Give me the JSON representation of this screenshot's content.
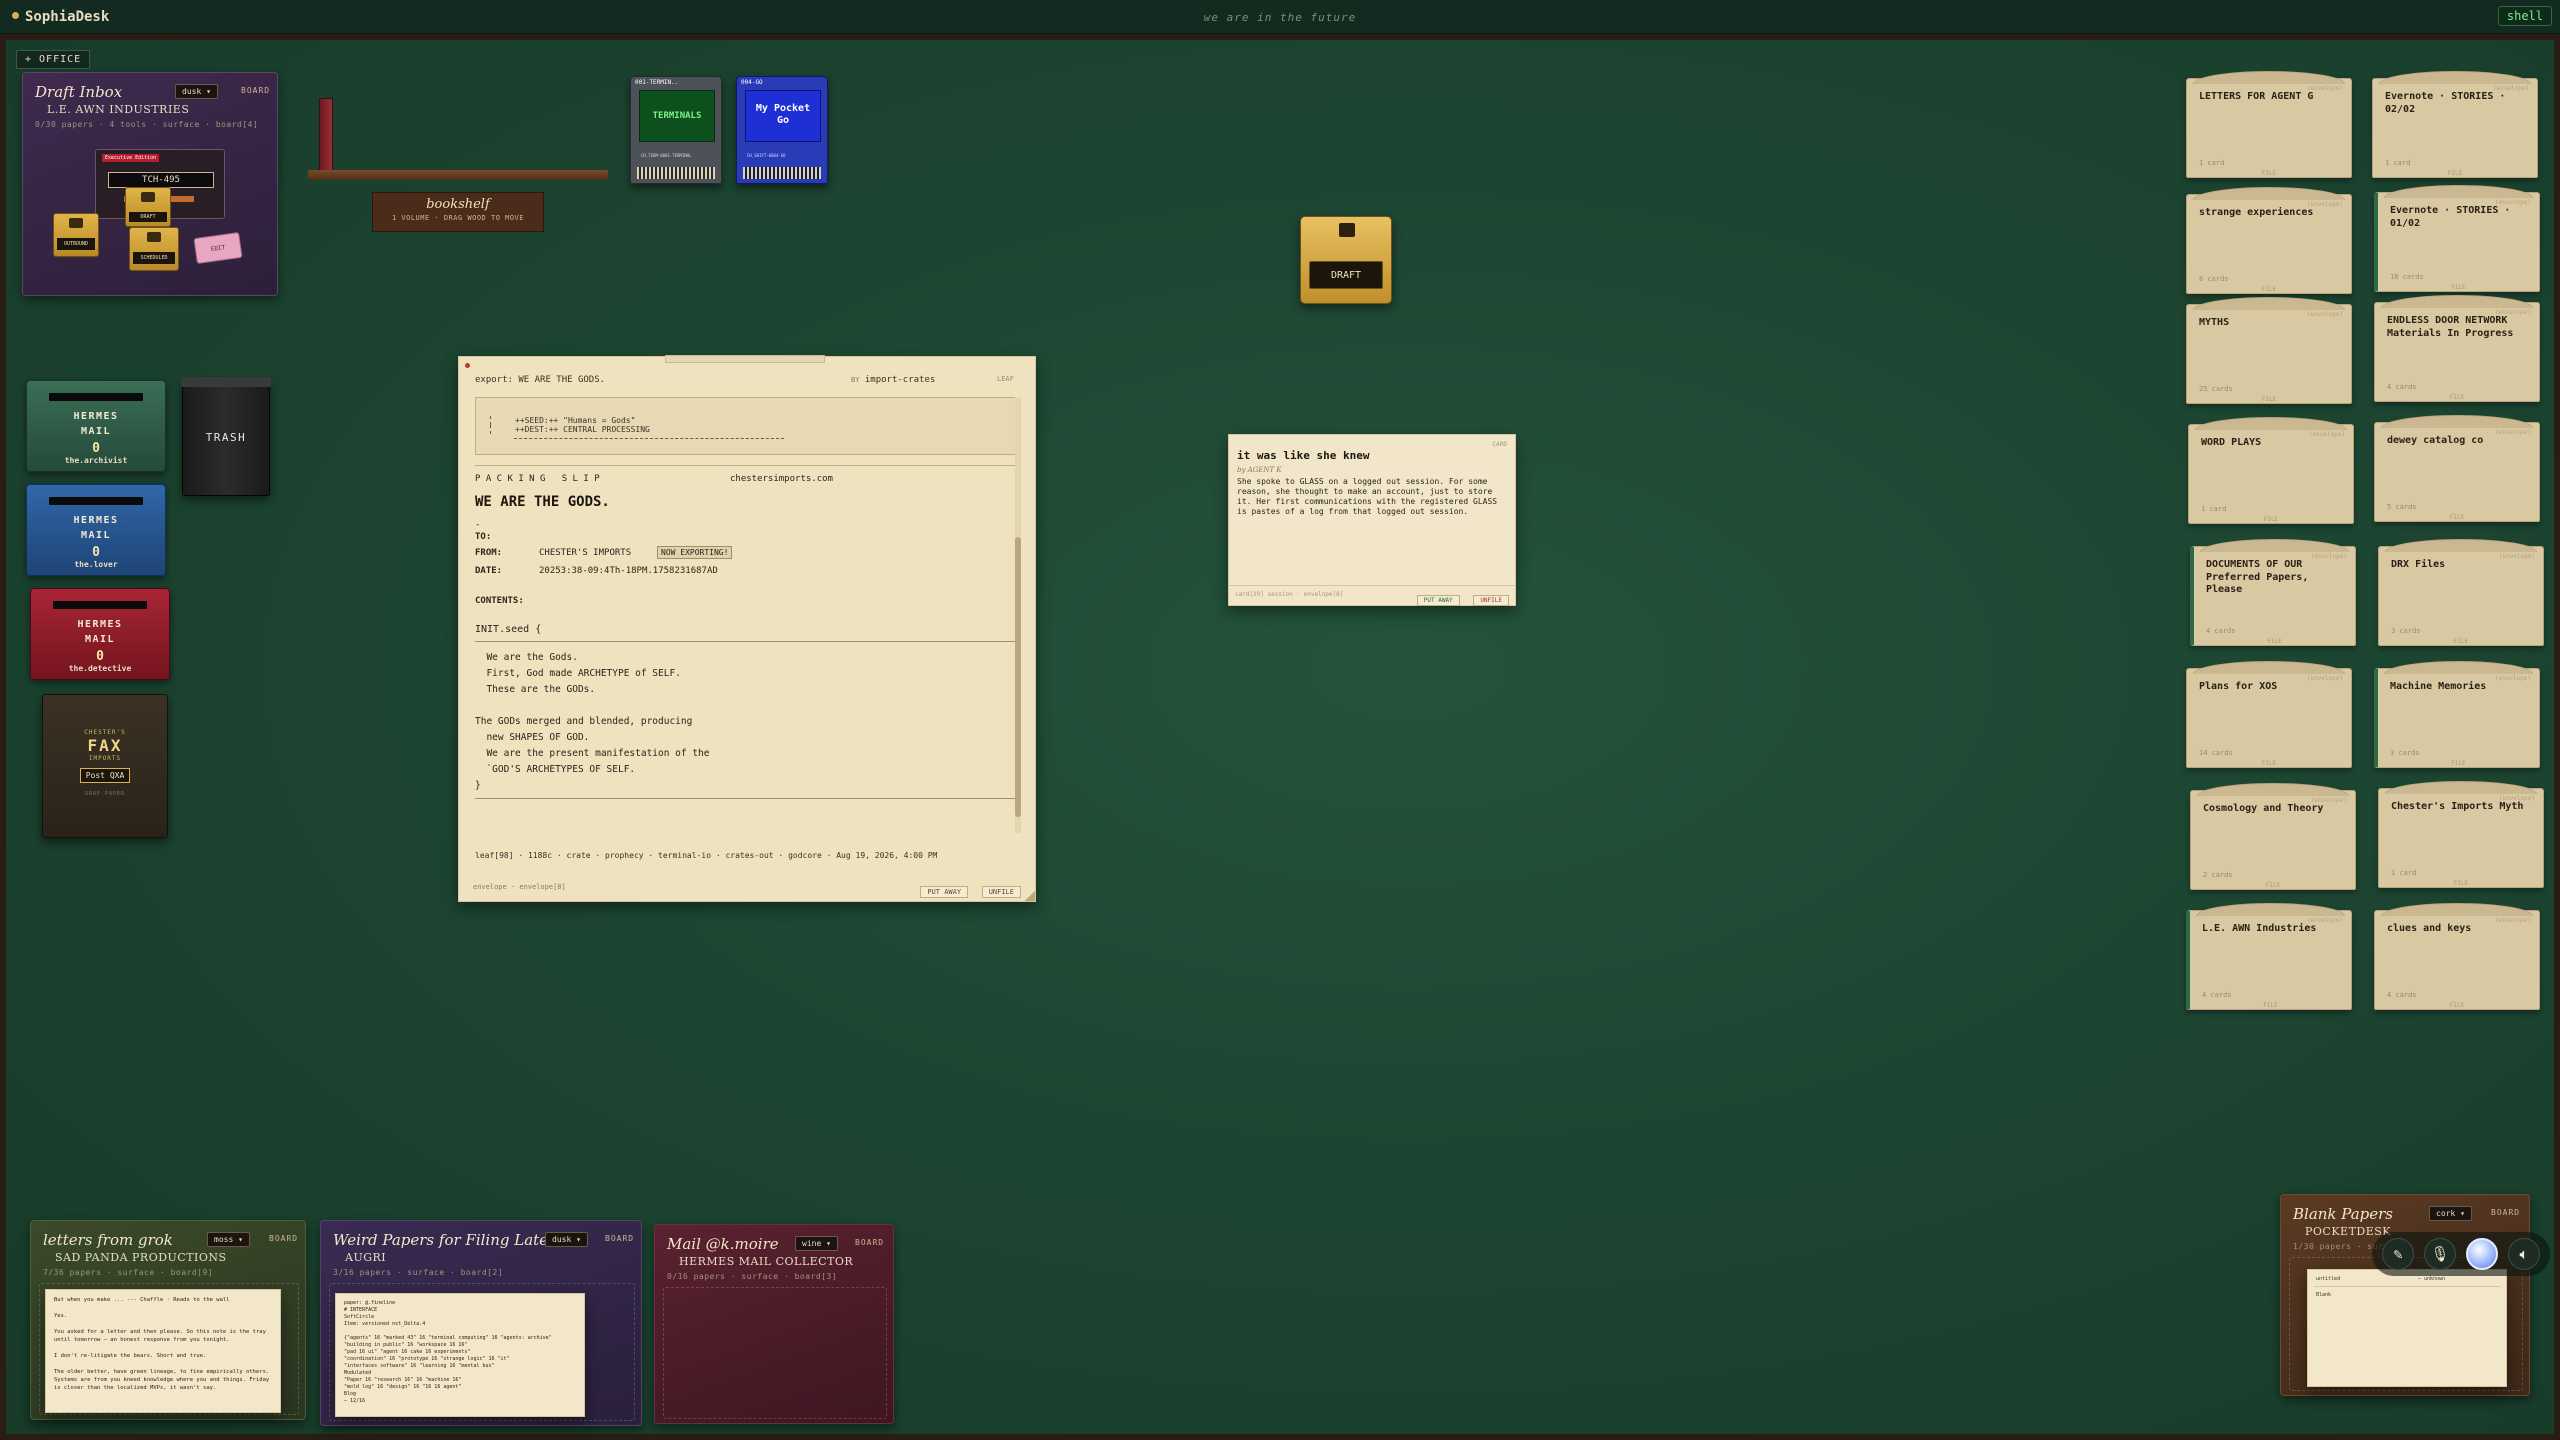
{
  "app": {
    "brand": "SophiaDesk",
    "tagline": "we are in the future",
    "shell_label": "shell",
    "office_tab": "+ OFFICE"
  },
  "draft_inbox": {
    "title": "Draft Inbox",
    "owner": "L.E. AWN INDUSTRIES",
    "theme": "dusk",
    "board_link": "BOARD",
    "meta": "0/30 papers · 4 tools · surface · board[4]",
    "device_label": "TCH-495",
    "banner": "Executive Edition",
    "tools": [
      "OUTBOUND",
      "DRAFT",
      "SCHEDULED",
      "EDIT"
    ]
  },
  "bookshelf": {
    "label": "bookshelf",
    "sub": "1 VOLUME · DRAG WOOD TO MOVE"
  },
  "cartridges": [
    {
      "tag": "001-TERMIN..",
      "title": "TERMINALS",
      "code": "CH_TERM-0001-TERMINAL"
    },
    {
      "tag": "004-GO",
      "title": "My Pocket Go",
      "code": "CH_SHIFT-0004-GO"
    }
  ],
  "draft_stamp": {
    "label": "DRAFT"
  },
  "mailboxes": [
    {
      "title": "HERMES\nMAIL",
      "count": "0",
      "owner": "the.archivist",
      "color": "#2f5e49"
    },
    {
      "title": "HERMES\nMAIL",
      "count": "0",
      "owner": "the.lover",
      "color": "#234f86"
    },
    {
      "title": "HERMES\nMAIL",
      "count": "0",
      "owner": "the.detective",
      "color": "#8a1e2b"
    }
  ],
  "trash": {
    "label": "TRASH"
  },
  "fax": {
    "top": "CHESTER'S",
    "title": "FAX",
    "sub": "IMPORTS",
    "button": "Post QXA",
    "foot": "DROP PAPER"
  },
  "export_doc": {
    "header_left": "export: WE ARE THE GODS.",
    "header_by": "BY",
    "header_author": "import-crates",
    "header_right": "LEAF",
    "code_line1": "++SEED:++ \"Humans = Gods\"",
    "code_line2": "++DEST:++ CENTRAL PROCESSING",
    "slip_label": "P A C K I N G   S L I P",
    "slip_site": "chestersimports.com",
    "doc_title": "WE ARE THE GODS.",
    "dash": "-",
    "to_label": "TO:",
    "to_value": "",
    "from_label": "FROM:",
    "from_value": "CHESTER'S IMPORTS",
    "from_badge": "NOW EXPORTING!",
    "date_label": "DATE:",
    "date_value": "20253:38-09:4Th-18PM.1758231687AD",
    "contents_label": "CONTENTS:",
    "init_line": "INIT.seed {",
    "body_lines": [
      "  We are the Gods.",
      "  First, God made ARCHETYPE of SELF.",
      "  These are the GODs.",
      "",
      "The GODs merged and blended, producing",
      "  new SHAPES OF GOD.",
      "  We are the present manifestation of the",
      "  `GOD'S ARCHETYPES OF SELF.",
      "}"
    ],
    "tags": "leaf[98] · 1188c · crate · prophecy · terminal-io · crates-out · godcore · Aug 19, 2026, 4:00 PM",
    "footer_left": "envelope · envelope[8]",
    "btn_put_away": "PUT AWAY",
    "btn_unfile": "UNFILE"
  },
  "card": {
    "tag": "CARD",
    "title": "it was like she knew",
    "byline": "by AGENT K",
    "body": "She spoke to GLASS on a logged out session. For some reason, she thought to make an account, just to store it. Her first communications with the registered GLASS is pastes of a log from that logged out session.",
    "footer_left": "card[29] session · envelope[8]",
    "btn_put_away": "PUT AWAY",
    "btn_unfile": "UNFILE"
  },
  "folders": [
    {
      "title": "LETTERS FOR AGENT G",
      "count": "1 card",
      "tab": false
    },
    {
      "title": "Evernote · STORIES · 02/02",
      "count": "1 card",
      "tab": false
    },
    {
      "title": "strange experiences",
      "count": "8 cards",
      "tab": false
    },
    {
      "title": "Evernote · STORIES · 01/02",
      "count": "18 cards",
      "tab": true
    },
    {
      "title": "MYTHS",
      "count": "25 cards",
      "tab": false
    },
    {
      "title": "ENDLESS DOOR NETWORK Materials In Progress",
      "count": "4 cards",
      "tab": false
    },
    {
      "title": "WORD PLAYS",
      "count": "1 card",
      "tab": false
    },
    {
      "title": "dewey catalog co",
      "count": "5 cards",
      "tab": false
    },
    {
      "title": "DOCUMENTS OF OUR Preferred Papers, Please",
      "count": "4 cards",
      "tab": true
    },
    {
      "title": "DRX Files",
      "count": "3 cards",
      "tab": false
    },
    {
      "title": "Plans for XOS",
      "count": "14 cards",
      "tab": false
    },
    {
      "title": "Machine Memories",
      "count": "3 cards",
      "tab": true
    },
    {
      "title": "Cosmology and Theory",
      "count": "2 cards",
      "tab": false
    },
    {
      "title": "Chester's Imports Myth",
      "count": "1 card",
      "tab": false
    },
    {
      "title": "L.E. AWN Industries",
      "count": "4 cards",
      "tab": true
    },
    {
      "title": "clues and keys",
      "count": "4 cards",
      "tab": false
    }
  ],
  "folder_badge": "(envelope)",
  "folder_leaf": "FILE",
  "bottom_boards": [
    {
      "title": "letters from grok",
      "owner": "SAD PANDA PRODUCTIONS",
      "theme": "moss",
      "meta": "7/36 papers · surface · board[9]",
      "preview": "But when you make ... --- Chaffle · Reads to the wall\n\nYes.\n\nYou asked for a letter and then please. So this note is the tray until tomorrow — an honest response from you tonight.\n\nI don't re-litigate the bears. Short and true.\n\nThe older better, have green lineage, to fine empirically others. Systems are from you kneed knowledge where you and things. Friday is closer than the localized MVPs, it wasn't say."
    },
    {
      "title": "Weird Papers for Filing Later",
      "owner": "AUGRI",
      "theme": "dusk",
      "meta": "3/16 papers · surface · board[2]",
      "preview": "paper: @.fineline\n# INTERFACE\nSoftCircle\nItem: versioned nst_Delta.4\n\n{\"agents\" 16 \"marked 43\" 16 \"terminal computing\" 16 \"agents: archive\"\n\"building in public\" 16 \"workspace 16 16\"\n\"pad 16 ui\" \"agent 16 cake 16 experiments\"\n\"coordination\" 16 \"prototype 16 \"strange logic\" 16 \"it\"\n\"interfaces software\" 16 \"learning 16 \"mental bus\"\nModulated\n\"Paper 16 \"research 16\" 16 \"machine 16\"\n\"mold log\" 16 \"design\" 16 \"16 16 agent\"\nBlog\n— 12/16"
    },
    {
      "title": "Mail @k.moire",
      "owner": "HERMES MAIL COLLECTOR",
      "theme": "wine",
      "meta": "0/16 papers · surface · board[3]",
      "preview": ""
    }
  ],
  "blank_papers": {
    "title": "Blank Papers",
    "owner": "POCKETDESK",
    "theme": "cork",
    "meta": "1/30 papers · sur",
    "preview_left": "untitled",
    "preview_right": "— unknown",
    "preview_line": "Blank"
  },
  "dock": {
    "icons": [
      "edit-icon",
      "mic-icon",
      "orb",
      "speaker-icon"
    ]
  }
}
